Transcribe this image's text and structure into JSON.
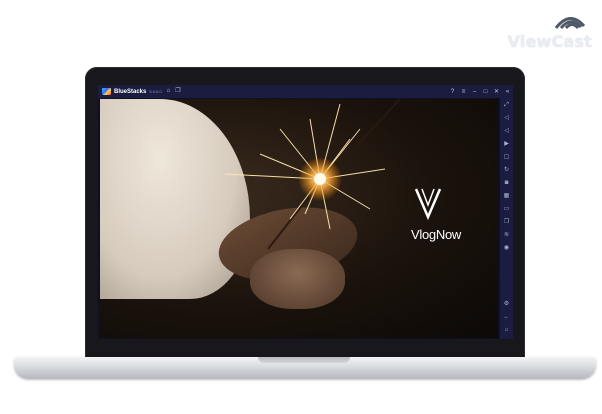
{
  "watermark": {
    "brand": "ViewCast",
    "icon": "wifi-signal-icon"
  },
  "window": {
    "app_name": "BlueStacks",
    "app_version": "5.0.0.0",
    "titlebar_icons": [
      "home-icon",
      "multi-instance-icon"
    ],
    "controls": [
      "help-icon",
      "menu-icon",
      "minimize-icon",
      "maximize-icon",
      "close-icon",
      "collapse-sidebar-icon"
    ]
  },
  "content": {
    "brand_name": "VlogNow",
    "logo_icon": "vlognow-v-logo-icon"
  },
  "sidebar": {
    "icons": [
      "fullscreen-icon",
      "volume-up-icon",
      "volume-down-icon",
      "media-icon",
      "screenshot-icon",
      "rotate-icon",
      "gamepad-icon",
      "keyboard-icon",
      "folder-icon",
      "copy-icon",
      "layers-icon",
      "eco-mode-icon",
      "settings-icon",
      "back-icon",
      "home-icon",
      "recent-apps-icon"
    ]
  },
  "colors": {
    "titlebar": "#1a1d3f",
    "sidebar": "#1a1d3f",
    "laptop_bezel": "#17171c",
    "watermark_text": "#e9edf2"
  }
}
